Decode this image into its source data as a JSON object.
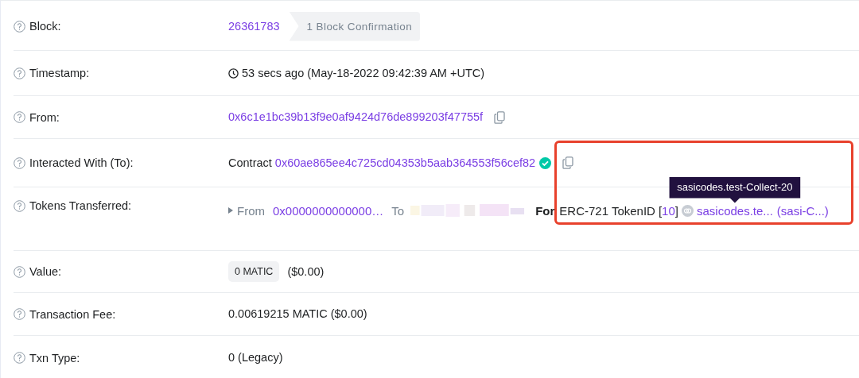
{
  "rows": [
    {
      "kind": "block",
      "label": "Block:",
      "value": "26361783",
      "badge": "1 Block Confirmation"
    },
    {
      "kind": "timestamp",
      "label": "Timestamp:",
      "value": "53 secs ago (May-18-2022 09:42:39 AM +UTC)"
    },
    {
      "kind": "address",
      "label": "From:",
      "value": "0x6c1e1bc39b13f9e0af9424d76de899203f47755f"
    },
    {
      "kind": "contract",
      "label": "Interacted With (To):",
      "prefix": "Contract",
      "value": "0x60ae865ee4c725cd04353b5aab364553f56cef82",
      "verified": true
    },
    {
      "kind": "tokens",
      "label": "Tokens Transferred:",
      "from_label": "From",
      "from": "0x0000000000000…",
      "to_label": "To",
      "to_redacted": true,
      "for_label": "For",
      "standard": "ERC-721 TokenID",
      "token_open": "[",
      "token_id": "10",
      "token_close": "]",
      "token_name": "sasicodes.te...",
      "symbol": "(sasi-C...)",
      "tooltip": "sasicodes.test-Collect-20"
    },
    {
      "kind": "value",
      "label": "Value:",
      "badge": "0 MATIC",
      "value": "($0.00)"
    },
    {
      "kind": "text",
      "label": "Transaction Fee:",
      "value": "0.00619215 MATIC ($0.00)"
    },
    {
      "kind": "text",
      "label": "Txn Type:",
      "value": "0 (Legacy)"
    }
  ]
}
